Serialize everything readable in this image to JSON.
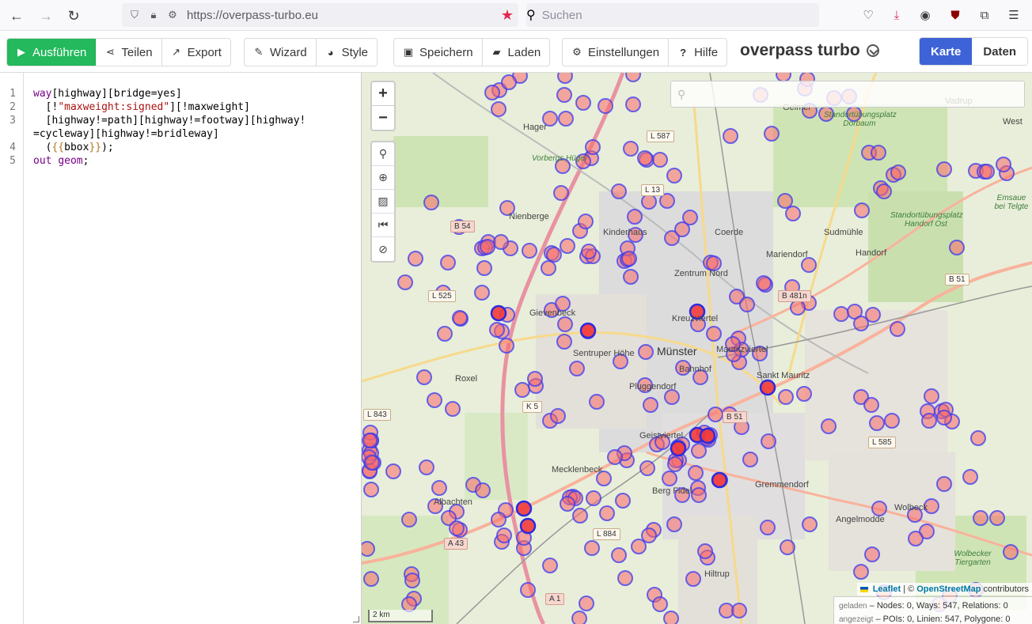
{
  "browser": {
    "url": "https://overpass-turbo.eu",
    "search_placeholder": "Suchen"
  },
  "toolbar": {
    "run": "Ausführen",
    "share": "Teilen",
    "export": "Export",
    "wizard": "Wizard",
    "style": "Style",
    "save": "Speichern",
    "load": "Laden",
    "settings": "Einstellungen",
    "help": "Hilfe",
    "app_title": "overpass turbo",
    "view_map": "Karte",
    "view_data": "Daten"
  },
  "editor": {
    "line_numbers": [
      "1",
      "2",
      "3",
      "",
      "4",
      "5"
    ]
  },
  "map": {
    "labels": [
      {
        "text": "Hager",
        "cls": ""
      },
      {
        "text": "Nienberge",
        "cls": ""
      },
      {
        "text": "Kinderhaus",
        "cls": ""
      },
      {
        "text": "Coerde",
        "cls": ""
      },
      {
        "text": "Sudmühle",
        "cls": ""
      },
      {
        "text": "Handorf",
        "cls": ""
      },
      {
        "text": "Mariendorf",
        "cls": ""
      },
      {
        "text": "Zentrum Nord",
        "cls": ""
      },
      {
        "text": "Gievenbeck",
        "cls": ""
      },
      {
        "text": "Kreuzviertel",
        "cls": ""
      },
      {
        "text": "Münster",
        "cls": "big"
      },
      {
        "text": "Mauritzviertel",
        "cls": ""
      },
      {
        "text": "Sentruper Höhe",
        "cls": ""
      },
      {
        "text": "Bahnhof",
        "cls": ""
      },
      {
        "text": "Sankt Mauritz",
        "cls": ""
      },
      {
        "text": "Roxel",
        "cls": ""
      },
      {
        "text": "Pluggendorf",
        "cls": ""
      },
      {
        "text": "Geistviertel",
        "cls": ""
      },
      {
        "text": "Mecklenbeck",
        "cls": ""
      },
      {
        "text": "Berg Fidel",
        "cls": ""
      },
      {
        "text": "Gremmendorf",
        "cls": ""
      },
      {
        "text": "Angelmodde",
        "cls": ""
      },
      {
        "text": "Wolbeck",
        "cls": ""
      },
      {
        "text": "Albachten",
        "cls": ""
      },
      {
        "text": "Hiltrup",
        "cls": ""
      },
      {
        "text": "Gelmer",
        "cls": ""
      },
      {
        "text": "Vadrup",
        "cls": ""
      },
      {
        "text": "West",
        "cls": ""
      },
      {
        "text": "Vorbergs Hügel",
        "cls": "green"
      },
      {
        "text": "Standortübungsplatz Dorbaum",
        "cls": "green"
      },
      {
        "text": "Standortübungsplatz Handorf Ost",
        "cls": "green"
      },
      {
        "text": "Ems­aue bei Telgte",
        "cls": "green"
      },
      {
        "text": "Wolbecker Tiergarten",
        "cls": "green"
      }
    ],
    "shields": [
      {
        "text": "L 587",
        "cls": ""
      },
      {
        "text": "L 13",
        "cls": ""
      },
      {
        "text": "B 54",
        "cls": "b"
      },
      {
        "text": "L 525",
        "cls": ""
      },
      {
        "text": "B 481n",
        "cls": "b"
      },
      {
        "text": "B 51",
        "cls": ""
      },
      {
        "text": "L 843",
        "cls": ""
      },
      {
        "text": "K 5",
        "cls": ""
      },
      {
        "text": "B 51",
        "cls": "b"
      },
      {
        "text": "L 585",
        "cls": ""
      },
      {
        "text": "L 884",
        "cls": ""
      },
      {
        "text": "A 43",
        "cls": "b"
      },
      {
        "text": "A 1",
        "cls": "b"
      }
    ],
    "attribution_leaflet": "Leaflet",
    "attribution_sep": "| ©",
    "attribution_osm": "OpenStreetMap",
    "attribution_suffix": "contributors",
    "stats_loaded_label": "geladen",
    "stats_loaded": "– Nodes: 0, Ways: 547, Relations: 0",
    "stats_shown_label": "angezeigt",
    "stats_shown": "– POIs: 0, Linien: 547, Polygone: 0",
    "scale": "2 km",
    "colors": {
      "marker_fill": "#f86a6a",
      "marker_stroke": "#3b3bf0",
      "accent_run": "#23b95c",
      "accent_view": "#3e63d6"
    }
  }
}
